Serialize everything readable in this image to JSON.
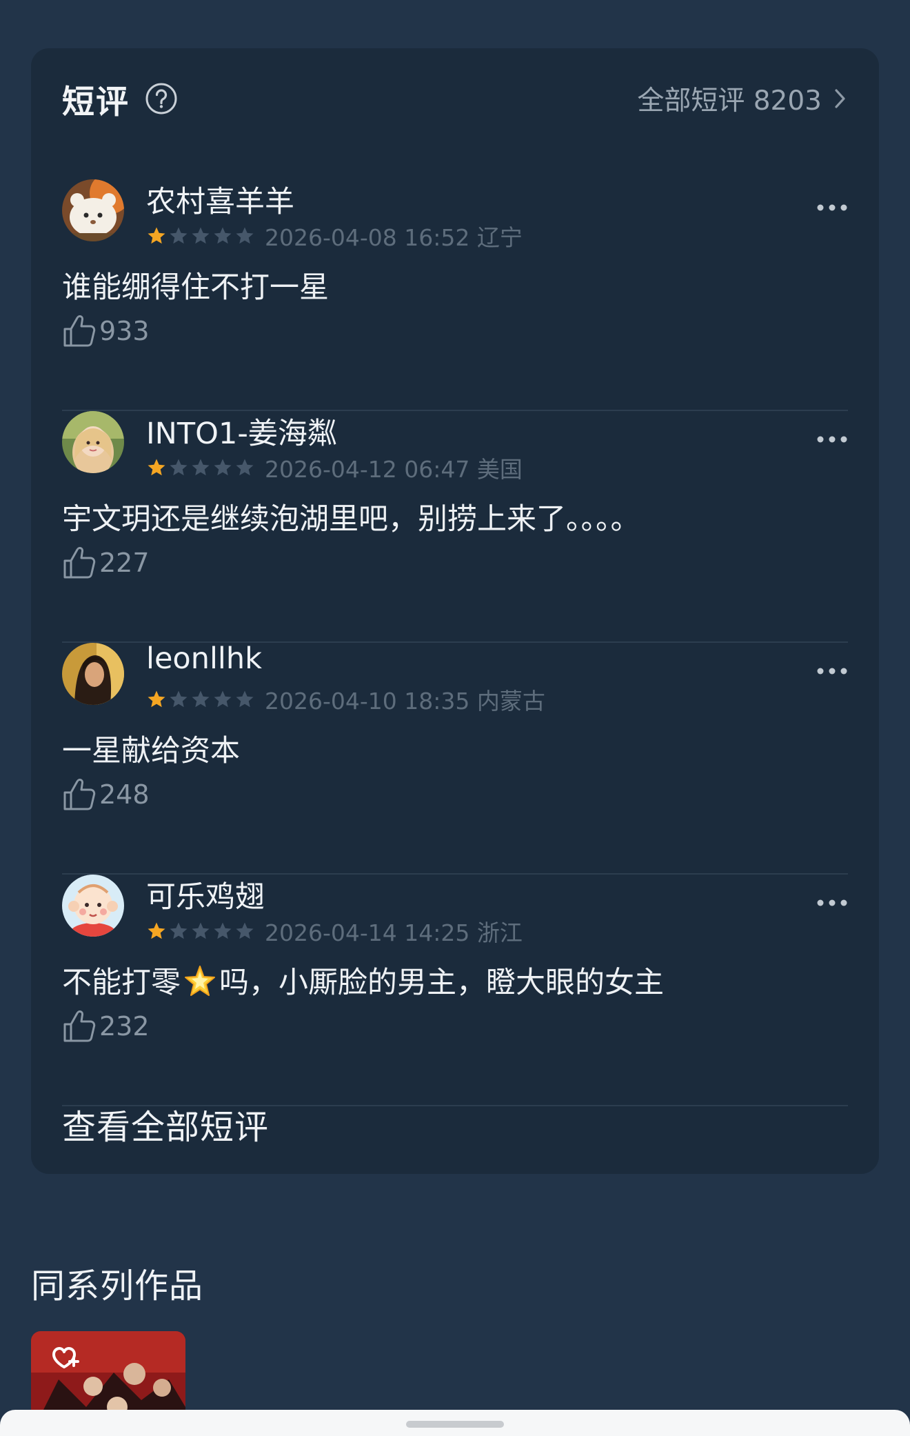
{
  "short_reviews": {
    "title": "短评",
    "all_link": "全部短评 8203",
    "view_all_label": "查看全部短评",
    "items": [
      {
        "username": "农村喜羊羊",
        "rating": 1,
        "meta": "2026-04-08 16:52 辽宁",
        "comment": "谁能绷得住不打一星",
        "likes": "933"
      },
      {
        "username": "INTO1-姜海粼",
        "rating": 1,
        "meta": "2026-04-12 06:47 美国",
        "comment": "宇文玥还是继续泡湖里吧，别捞上来了。。。。",
        "likes": "227"
      },
      {
        "username": "leonllhk",
        "rating": 1,
        "meta": "2026-04-10 18:35 内蒙古",
        "comment": "一星献给资本",
        "likes": "248"
      },
      {
        "username": "可乐鸡翅",
        "rating": 1,
        "meta": "2026-04-14 14:25 浙江",
        "comment_before": "不能打零",
        "comment_after": "吗，小厮脸的男主，瞪大眼的女主",
        "likes": "232"
      }
    ]
  },
  "series": {
    "title": "同系列作品"
  },
  "colors": {
    "page_bg": "#223449",
    "card_bg": "#1b2b3c",
    "star_filled": "#f5a623",
    "star_empty": "#46576a"
  }
}
